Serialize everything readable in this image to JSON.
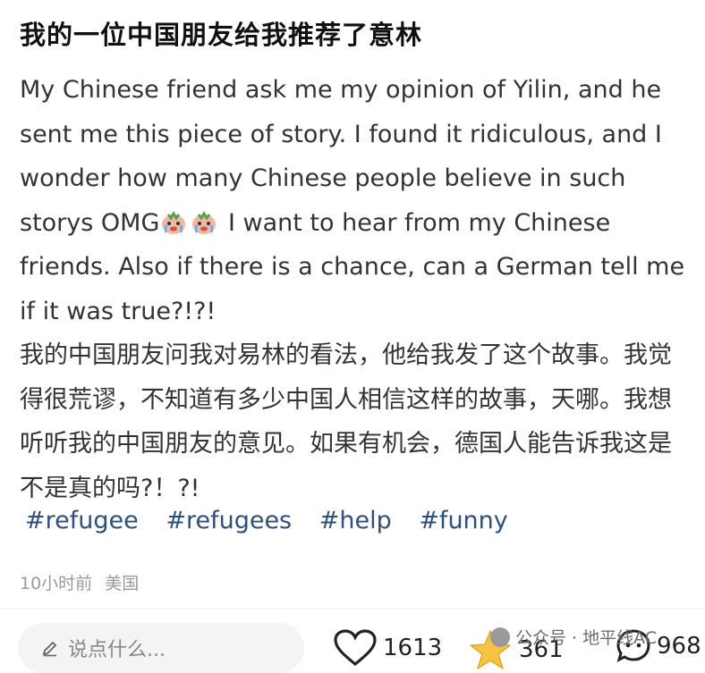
{
  "post": {
    "title": "我的一位中国朋友给我推荐了意林",
    "body_en_1": "My Chinese friend ask me my opinion of Yilin, and he sent me this piece of story. I found it ridiculous, and I wonder how many Chinese people believe in such storys OMG",
    "body_en_2": " I want to hear from my Chinese friends. Also if there is a chance, can a German tell me if it was true?!?!",
    "body_zh": "我的中国朋友问我对易林的看法，他给我发了这个故事。我觉得很荒谬，不知道有多少中国人相信这样的故事，天哪。我想听听我的中国朋友的意见。如果有机会，德国人能告诉我这是不是真的吗?！?!",
    "emoji": "crying-face-emoji",
    "tags": [
      "#refugee",
      "#refugees",
      "#help",
      "#funny"
    ],
    "time": "10小时前",
    "location": "美国"
  },
  "footer": {
    "comment_placeholder": "说点什么...",
    "likes": "1613",
    "stars": "361",
    "comments": "968"
  },
  "watermark": {
    "text": "公众号 · 地平线AC"
  },
  "colors": {
    "tag": "#2e4f7d",
    "meta": "#9a9a9a",
    "star": "#f6c343"
  }
}
